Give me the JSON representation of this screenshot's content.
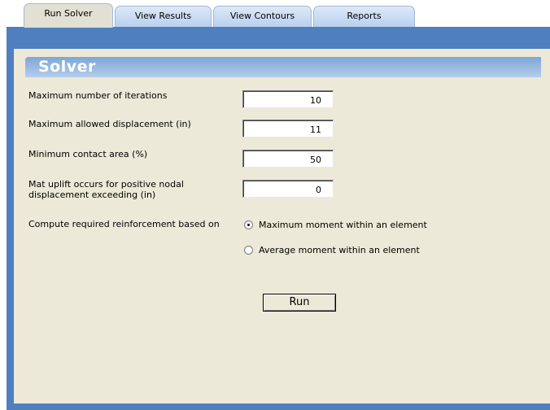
{
  "tabs": [
    {
      "label": "Run Solver",
      "active": true
    },
    {
      "label": "View Results",
      "active": false
    },
    {
      "label": "View Contours",
      "active": false
    },
    {
      "label": "Reports",
      "active": false
    }
  ],
  "section": {
    "title": "Solver"
  },
  "fields": [
    {
      "label": "Maximum number of iterations",
      "value": "10"
    },
    {
      "label": "Maximum allowed displacement (in)",
      "value": "11"
    },
    {
      "label": "Minimum contact area (%)",
      "value": "50"
    },
    {
      "label_line1": "Mat uplift occurs for positive nodal",
      "label_line2": "displacement exceeding (in)",
      "value": "0"
    }
  ],
  "reinforcement": {
    "label": "Compute required reinforcement based on",
    "options": [
      {
        "label": "Maximum moment within an element",
        "checked": true
      },
      {
        "label": "Average moment within an element",
        "checked": false
      }
    ]
  },
  "run_button": {
    "label": "Run"
  },
  "colors": {
    "frame": "#4f7fbf",
    "panel": "#ece9d8",
    "header": "#8db1dd"
  }
}
